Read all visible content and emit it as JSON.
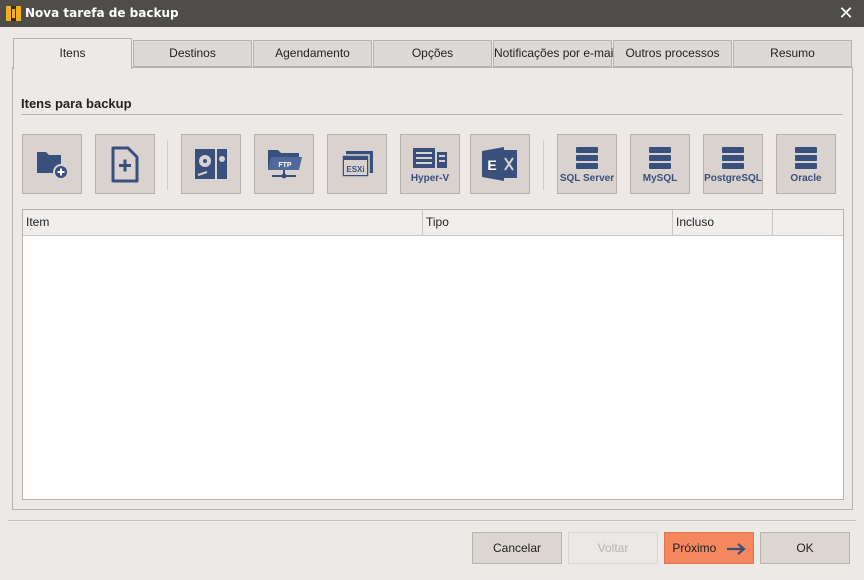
{
  "window": {
    "title": "Nova tarefa de backup",
    "close_glyph": "✕"
  },
  "tabs": [
    {
      "label": "Itens",
      "active": true
    },
    {
      "label": "Destinos"
    },
    {
      "label": "Agendamento"
    },
    {
      "label": "Opções"
    },
    {
      "label": "Notificações por e-mail"
    },
    {
      "label": "Outros processos"
    },
    {
      "label": "Resumo"
    }
  ],
  "section": {
    "title": "Itens para backup"
  },
  "toolbar": [
    {
      "icon": "add-folder-icon"
    },
    {
      "icon": "add-file-icon"
    },
    {
      "icon": "disk-image-icon"
    },
    {
      "icon": "ftp-folder-icon",
      "inner_text": "FTP"
    },
    {
      "icon": "esxi-icon",
      "inner_text": "ESXi"
    },
    {
      "icon": "hyper-v-icon",
      "label": "Hyper-V"
    },
    {
      "icon": "exchange-icon"
    },
    {
      "icon": "database-icon",
      "label": "SQL Server"
    },
    {
      "icon": "database-icon",
      "label": "MySQL"
    },
    {
      "icon": "database-icon",
      "label": "PostgreSQL"
    },
    {
      "icon": "database-icon",
      "label": "Oracle"
    }
  ],
  "table": {
    "columns": [
      "Item",
      "Tipo",
      "Incluso"
    ],
    "rows": []
  },
  "buttons": {
    "cancel": "Cancelar",
    "back": "Voltar",
    "next": "Próximo",
    "ok": "OK"
  },
  "colors": {
    "titlebar": "#4e4d4a",
    "icon_blue": "#39507d",
    "primary": "#f5875f"
  }
}
